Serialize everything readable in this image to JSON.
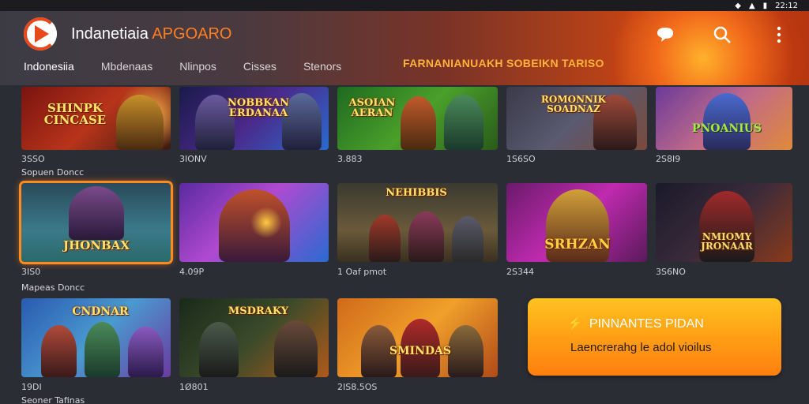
{
  "status_bar": {
    "time": "22:12"
  },
  "app": {
    "title_main": "Indanetiaia",
    "title_accent": "APGOARO"
  },
  "icons": {
    "logo": "play-logo-icon",
    "chat": "chat-bubble-icon",
    "search": "search-icon",
    "menu": "more-vert-icon"
  },
  "tabs": [
    {
      "label": "Indonesiia",
      "active": true
    },
    {
      "label": "Mbdenaas"
    },
    {
      "label": "Nlinpos"
    },
    {
      "label": "Cisses"
    },
    {
      "label": "Stenors"
    }
  ],
  "promo_text": "FARNANIANUAKH SOBEIKN TARISO",
  "sections": [
    {
      "label": "Sopuen Doncc"
    },
    {
      "label": "Mapeas Doncc"
    },
    {
      "label": "Seoner Tafinas"
    }
  ],
  "rows": [
    [
      {
        "title": "SHINPK CINCASE",
        "meta": "3SSO"
      },
      {
        "title": "NOBBKAN ERDANAA",
        "meta": "3IONV"
      },
      {
        "title": "ASOIAN AERAN",
        "meta": "3.883"
      },
      {
        "title": "ROMONNIK SOADNAZ",
        "meta": "1S6SO"
      },
      {
        "title": "PNOANIUS",
        "meta": "2S8I9"
      }
    ],
    [
      {
        "title": "JHONBAX",
        "meta": "3IS0"
      },
      {
        "title": "",
        "meta": "4.09P"
      },
      {
        "title": "NEHIBBIS",
        "meta": "1 Oaf pmot"
      },
      {
        "title": "SRHZAN",
        "meta": "2S344"
      },
      {
        "title": "NMIOMY JRONAAR",
        "meta": "3S6NO"
      }
    ],
    [
      {
        "title": "CNDNAR",
        "meta": "19DI"
      },
      {
        "title": "MSDRAKY",
        "meta": "1Ø801"
      },
      {
        "title": "SMINDAS",
        "meta": "2IS8.5OS"
      }
    ]
  ],
  "cta": {
    "line1": "PINNANTES PIDAN",
    "line2": "Laencrerahg le adol vioilus",
    "icon": "bolt-icon"
  },
  "colors": {
    "accent": "#ff8a1f",
    "promo": "#ffb238",
    "card_title": "#ffe36b"
  }
}
